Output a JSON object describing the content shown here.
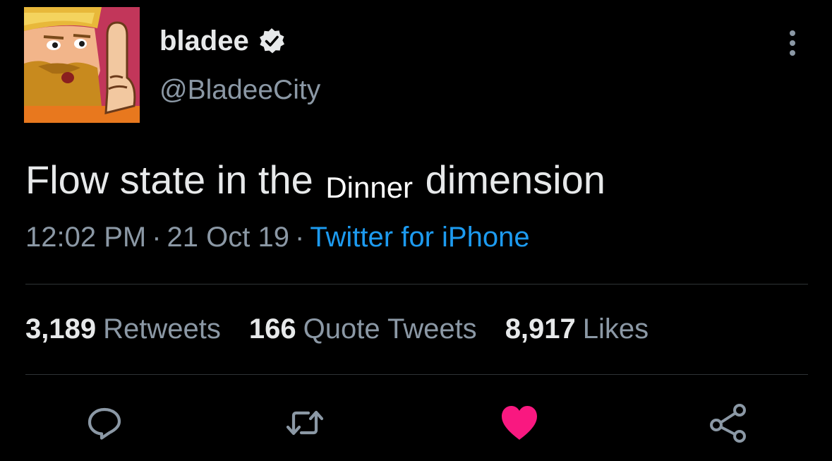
{
  "tweet": {
    "author": {
      "display_name": "bladee",
      "handle": "@BladeeCity",
      "verified": true,
      "avatar_icon": "cartoon-bearded-man-avatar"
    },
    "text_before": "Flow state in the",
    "text_inserted": "Dinner",
    "text_after": "dimension",
    "time": "12:02 PM",
    "date": "21 Oct 19",
    "separator": "·",
    "source": "Twitter for iPhone",
    "stats": {
      "retweets_count": "3,189",
      "retweets_label": "Retweets",
      "quotes_count": "166",
      "quotes_label": "Quote Tweets",
      "likes_count": "8,917",
      "likes_label": "Likes"
    },
    "actions": [
      "reply-icon",
      "retweet-icon",
      "like-icon",
      "share-icon"
    ],
    "liked": true
  },
  "colors": {
    "background": "#000000",
    "text_primary": "#e7e9ea",
    "text_secondary": "#8b98a5",
    "link": "#1d9bf0",
    "like": "#f91880",
    "divider": "#2f3336"
  }
}
